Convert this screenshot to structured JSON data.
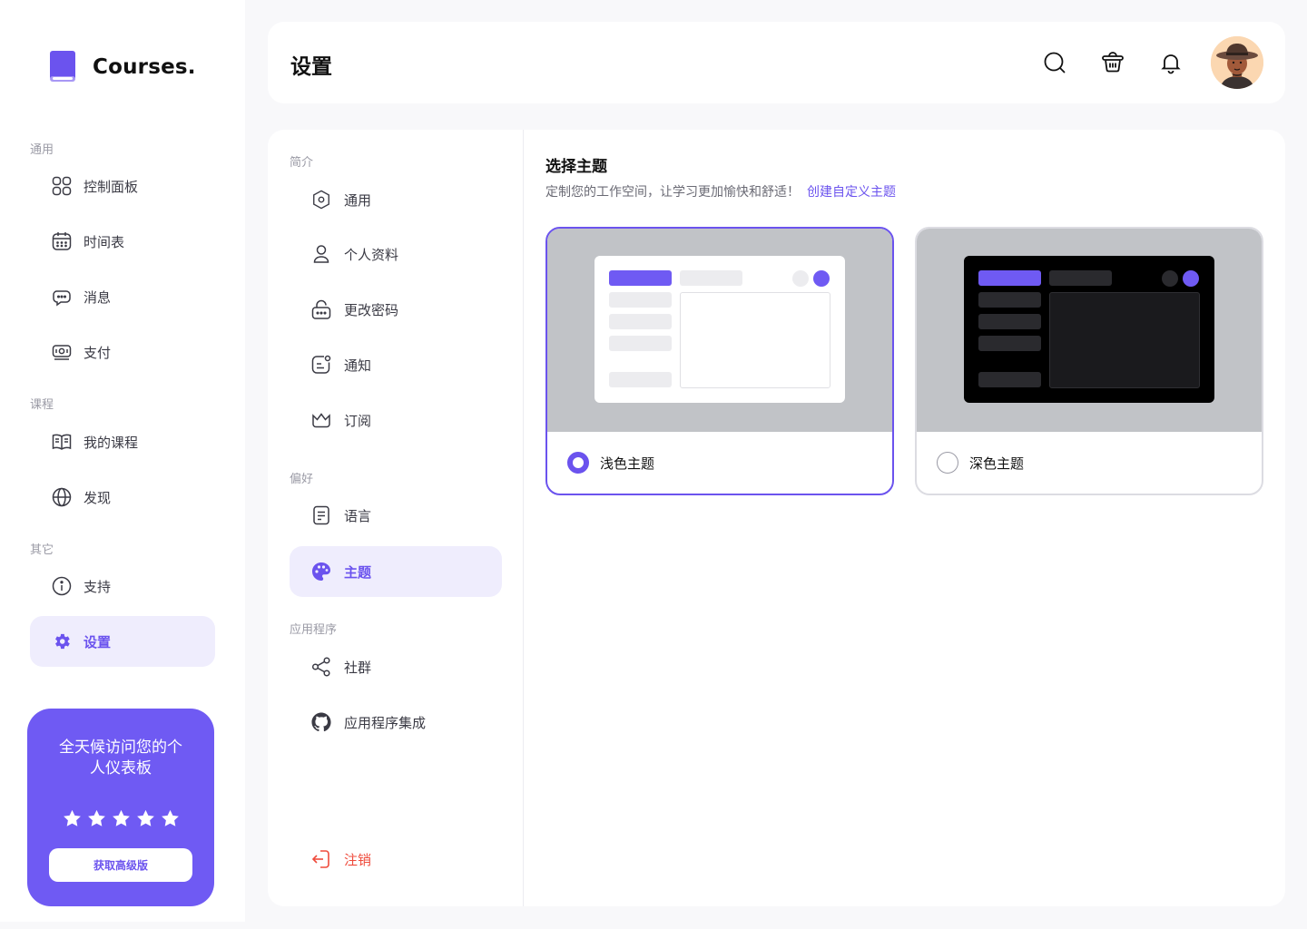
{
  "brand": {
    "name": "Courses."
  },
  "sidebar": {
    "sections": [
      {
        "label": "通用"
      },
      {
        "label": "课程"
      },
      {
        "label": "其它"
      }
    ],
    "items": [
      {
        "label": "控制面板",
        "icon": "grid-icon"
      },
      {
        "label": "时间表",
        "icon": "calendar-icon"
      },
      {
        "label": "消息",
        "icon": "chat-icon"
      },
      {
        "label": "支付",
        "icon": "money-icon"
      },
      {
        "label": "我的课程",
        "icon": "book-open-icon"
      },
      {
        "label": "发现",
        "icon": "globe-icon"
      },
      {
        "label": "支持",
        "icon": "info-icon"
      },
      {
        "label": "设置",
        "icon": "gear-icon",
        "active": true
      }
    ]
  },
  "promo": {
    "title": "全天候访问您的个人仪表板",
    "rating": 5,
    "button": "获取高级版"
  },
  "header": {
    "title": "设置",
    "icons": [
      "search-icon",
      "basket-icon",
      "bell-icon"
    ]
  },
  "settings_nav": {
    "sections": [
      {
        "label": "简介"
      },
      {
        "label": "偏好"
      },
      {
        "label": "应用程序"
      }
    ],
    "items": [
      {
        "label": "通用",
        "icon": "hexagon-icon"
      },
      {
        "label": "个人资料",
        "icon": "user-icon"
      },
      {
        "label": "更改密码",
        "icon": "lock-icon"
      },
      {
        "label": "通知",
        "icon": "notification-icon"
      },
      {
        "label": "订阅",
        "icon": "crown-icon"
      },
      {
        "label": "语言",
        "icon": "document-icon"
      },
      {
        "label": "主题",
        "icon": "palette-icon",
        "active": true
      },
      {
        "label": "社群",
        "icon": "share-icon"
      },
      {
        "label": "应用程序集成",
        "icon": "github-icon"
      }
    ],
    "logout": "注销"
  },
  "theme": {
    "title": "选择主题",
    "description": "定制您的工作空间，让学习更加愉快和舒适！",
    "link": "创建自定义主题",
    "options": [
      {
        "label": "浅色主题",
        "selected": true
      },
      {
        "label": "深色主题",
        "selected": false
      }
    ]
  },
  "colors": {
    "accent": "#6b53ee",
    "accent_light": "#efedfd",
    "promo": "#6f5af3",
    "logout": "#ef4b3c"
  }
}
